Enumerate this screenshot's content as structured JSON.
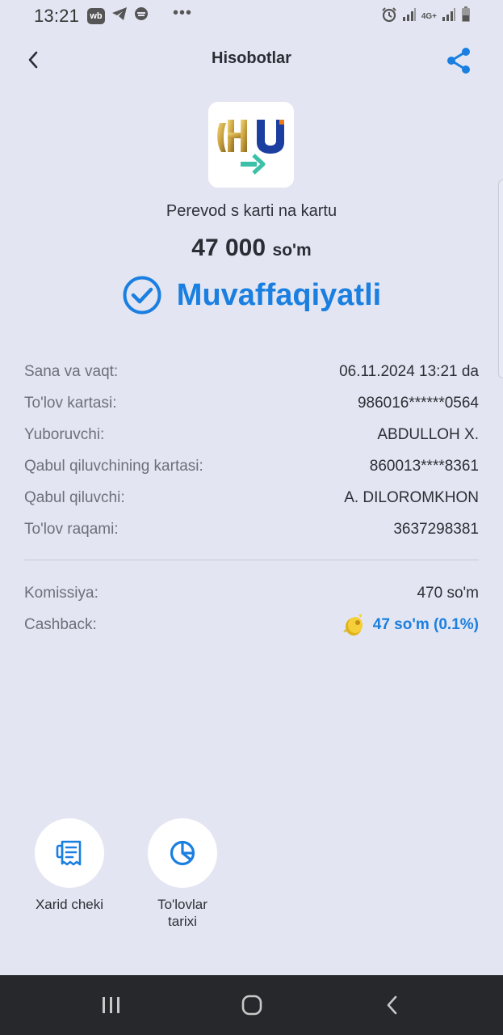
{
  "status_bar": {
    "time": "13:21",
    "wb_badge": "wb",
    "network": "4G+",
    "icons": [
      "wb-app-icon",
      "telegram-icon",
      "vpn-icon",
      "more-dots-icon",
      "alarm-icon",
      "signal-icon",
      "network-4g-icon",
      "battery-icon"
    ]
  },
  "header": {
    "title": "Hisobotlar",
    "back_icon": "chevron-left-icon",
    "share_icon": "share-icon"
  },
  "transaction": {
    "operation_title": "Perevod s karti na kartu",
    "amount": "47 000",
    "currency": "so'm",
    "status": "Muvaffaqiyatli"
  },
  "details": [
    {
      "label": "Sana va vaqt:",
      "value": "06.11.2024 13:21 da"
    },
    {
      "label": "To'lov kartasi:",
      "value": "986016******0564"
    },
    {
      "label": "Yuboruvchi:",
      "value": "ABDULLOH X."
    },
    {
      "label": "Qabul qiluvchining kartasi:",
      "value": "860013****8361"
    },
    {
      "label": "Qabul qiluvchi:",
      "value": "A. DILOROMKHON"
    },
    {
      "label": "To'lov raqami:",
      "value": "3637298381"
    }
  ],
  "fees": {
    "commission_label": "Komissiya:",
    "commission_value": "470 so'm",
    "cashback_label": "Cashback:",
    "cashback_value": "47 so'm (0.1%)"
  },
  "actions": [
    {
      "label": "Xarid cheki",
      "icon": "receipt-icon"
    },
    {
      "label": "To'lovlar tarixi",
      "icon": "pie-chart-icon"
    }
  ],
  "colors": {
    "background": "#e3e6f2",
    "accent": "#1a7fe0",
    "text": "#2a2d33",
    "muted": "#6d7079",
    "navbar": "#27282b"
  }
}
